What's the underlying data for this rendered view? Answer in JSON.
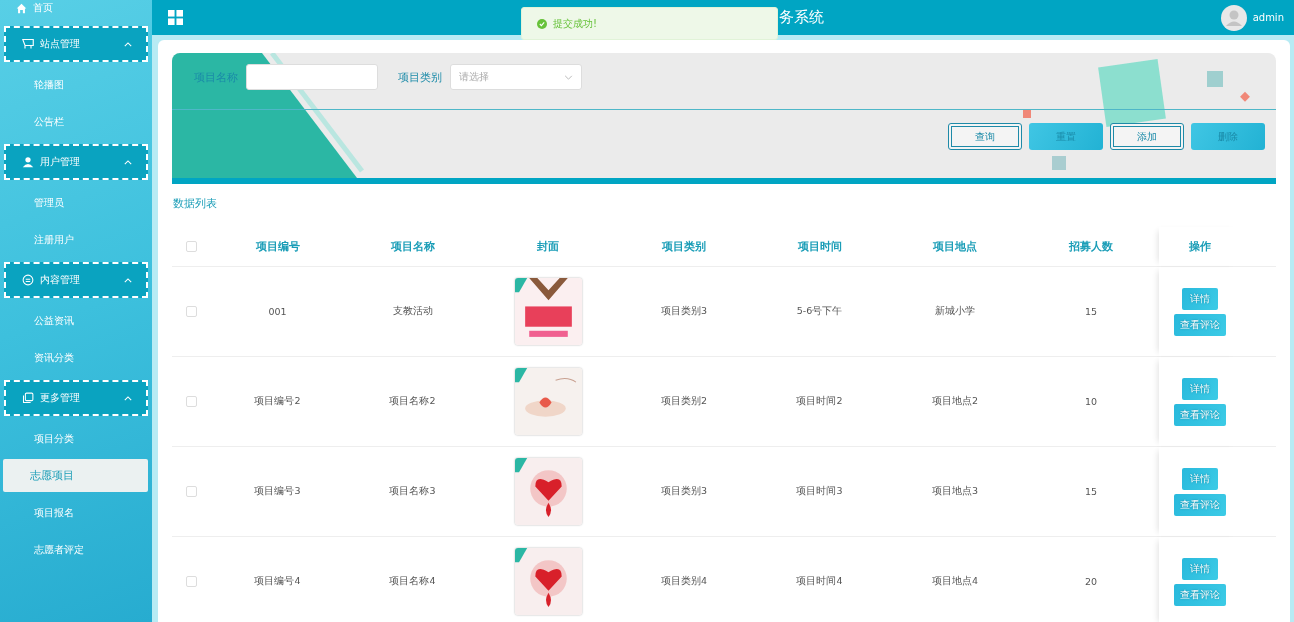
{
  "sidebar": {
    "home": {
      "label": "首页"
    },
    "groups": [
      {
        "label": "站点管理",
        "expanded": true,
        "items": [
          {
            "label": "轮播图",
            "selected": false
          },
          {
            "label": "公告栏",
            "selected": false
          }
        ]
      },
      {
        "label": "用户管理",
        "expanded": true,
        "items": [
          {
            "label": "管理员",
            "selected": false
          },
          {
            "label": "注册用户",
            "selected": false
          }
        ]
      },
      {
        "label": "内容管理",
        "expanded": true,
        "items": [
          {
            "label": "公益资讯",
            "selected": false
          },
          {
            "label": "资讯分类",
            "selected": false
          }
        ]
      },
      {
        "label": "更多管理",
        "expanded": true,
        "items": [
          {
            "label": "项目分类",
            "selected": false
          },
          {
            "label": "志愿项目",
            "selected": true
          },
          {
            "label": "项目报名",
            "selected": false
          },
          {
            "label": "志愿者评定",
            "selected": false
          }
        ]
      }
    ]
  },
  "header": {
    "title": "务系统",
    "user": "admin"
  },
  "toast": {
    "message": "提交成功!"
  },
  "search": {
    "name_label": "项目名称",
    "category_label": "项目类别",
    "category_placeholder": "请选择",
    "buttons": [
      {
        "label": "查询",
        "kind": "outlined"
      },
      {
        "label": "重置",
        "kind": "filled"
      },
      {
        "label": "添加",
        "kind": "outlined"
      },
      {
        "label": "删除",
        "kind": "filled"
      }
    ]
  },
  "table": {
    "title": "数据列表",
    "all_checked": false,
    "columns": [
      "项目编号",
      "项目名称",
      "封面",
      "项目类别",
      "项目时间",
      "项目地点",
      "招募人数",
      "操作"
    ],
    "rows": [
      {
        "checked": false,
        "number": "001",
        "name": "支教活动",
        "category": "项目类别3",
        "time": "5-6号下午",
        "place": "新城小学",
        "recruits": "15",
        "actions": [
          "详情",
          "查看评论"
        ]
      },
      {
        "checked": false,
        "number": "项目编号2",
        "name": "项目名称2",
        "category": "项目类别2",
        "time": "项目时间2",
        "place": "项目地点2",
        "recruits": "10",
        "actions": [
          "详情",
          "查看评论"
        ]
      },
      {
        "checked": false,
        "number": "项目编号3",
        "name": "项目名称3",
        "category": "项目类别3",
        "time": "项目时间3",
        "place": "项目地点3",
        "recruits": "15",
        "actions": [
          "详情",
          "查看评论"
        ]
      },
      {
        "checked": false,
        "number": "项目编号4",
        "name": "项目名称4",
        "category": "项目类别4",
        "time": "项目时间4",
        "place": "项目地点4",
        "recruits": "20",
        "actions": [
          "详情",
          "查看评论"
        ]
      }
    ]
  }
}
